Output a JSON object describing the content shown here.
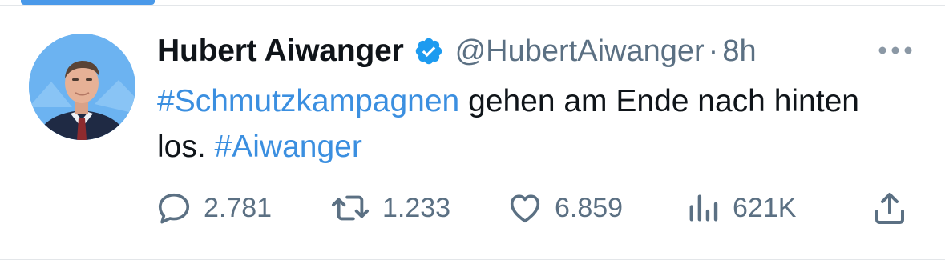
{
  "tweet": {
    "author": {
      "display_name": "Hubert Aiwanger",
      "handle": "@HubertAiwanger",
      "verified": true
    },
    "separator": "·",
    "time": "8h",
    "text_parts": {
      "hashtag1": "#Schmutzkampagnen",
      "text1": " gehen am Ende nach hinten los. ",
      "hashtag2": "#Aiwanger"
    },
    "stats": {
      "replies": "2.781",
      "retweets": "1.233",
      "likes": "6.859",
      "views": "621K"
    }
  },
  "icons": {
    "verified": "verified-badge-icon",
    "more": "more-options-icon",
    "reply": "reply-bubble-icon",
    "retweet": "retweet-icon",
    "like": "heart-icon",
    "views": "views-bar-chart-icon",
    "share": "share-upload-icon"
  },
  "colors": {
    "accent": "#1d9bf0",
    "hashtag": "#3b8fe0",
    "text_primary": "#0f1419",
    "text_secondary": "#5b7083"
  }
}
